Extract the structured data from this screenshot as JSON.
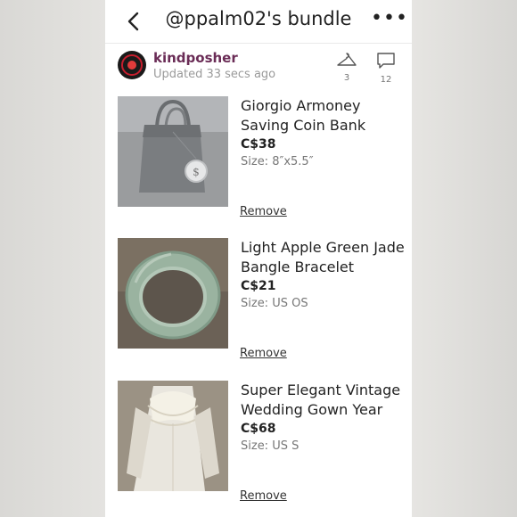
{
  "header": {
    "title": "@ppalm02's bundle",
    "more_glyph": "•••",
    "back_icon": "chevron-left-icon"
  },
  "seller": {
    "name": "kindposher",
    "updated": "Updated 33 secs ago",
    "likes_count": "3",
    "comments_count": "12"
  },
  "items": [
    {
      "name": "Giorgio Armoney Saving Coin Bank",
      "price": "C$38",
      "size": "Size: 8″x5.5″",
      "remove_label": "Remove"
    },
    {
      "name": "Light Apple Green Jade Bangle Bracelet",
      "price": "C$21",
      "size": "Size: US OS",
      "remove_label": "Remove"
    },
    {
      "name": "Super Elegant Vintage Wedding Gown Year",
      "price": "C$68",
      "size": "Size: US S",
      "remove_label": "Remove"
    }
  ],
  "colors": {
    "seller_name": "#6a2c56",
    "price": "#222222",
    "muted": "#777777"
  }
}
